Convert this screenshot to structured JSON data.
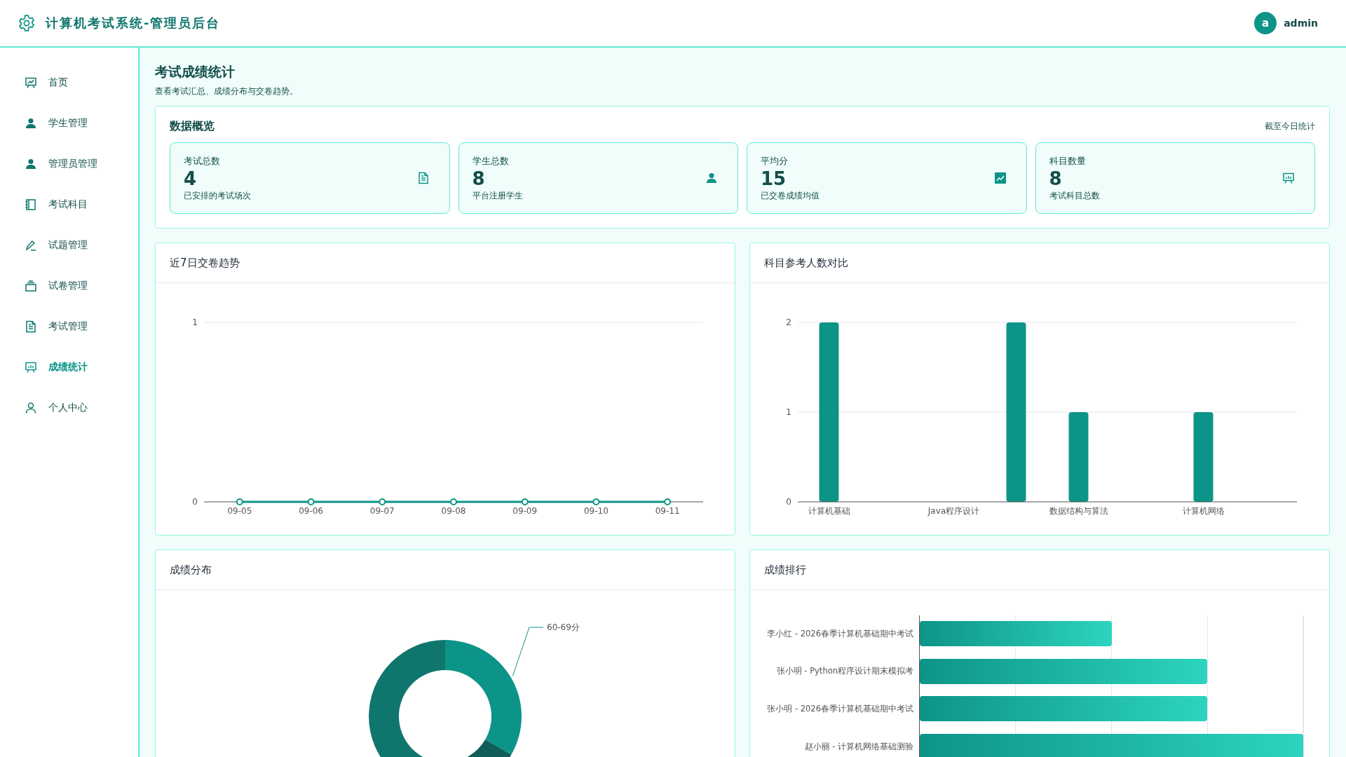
{
  "header": {
    "title": "计算机考试系统-管理员后台",
    "user": {
      "avatar_letter": "a",
      "name": "admin"
    }
  },
  "sidebar": {
    "items": [
      {
        "label": "首页",
        "selected": false
      },
      {
        "label": "学生管理",
        "selected": false
      },
      {
        "label": "管理员管理",
        "selected": false
      },
      {
        "label": "考试科目",
        "selected": false
      },
      {
        "label": "试题管理",
        "selected": false
      },
      {
        "label": "试卷管理",
        "selected": false
      },
      {
        "label": "考试管理",
        "selected": false
      },
      {
        "label": "成绩统计",
        "selected": true
      },
      {
        "label": "个人中心",
        "selected": false
      }
    ]
  },
  "page": {
    "title": "考试成绩统计",
    "subtitle": "查看考试汇总、成绩分布与交卷趋势。"
  },
  "overview": {
    "title": "数据概览",
    "note": "截至今日统计",
    "stats": [
      {
        "label": "考试总数",
        "value": "4",
        "caption": "已安排的考试场次"
      },
      {
        "label": "学生总数",
        "value": "8",
        "caption": "平台注册学生"
      },
      {
        "label": "平均分",
        "value": "15",
        "caption": "已交卷成绩均值"
      },
      {
        "label": "科目数量",
        "value": "8",
        "caption": "考试科目总数"
      }
    ]
  },
  "trend_panel": {
    "title": "近7日交卷趋势",
    "chart_data": {
      "type": "line",
      "categories": [
        "09-05",
        "09-06",
        "09-07",
        "09-08",
        "09-09",
        "09-10",
        "09-11"
      ],
      "series": [
        {
          "color": "#0d9488",
          "marker": "circle",
          "values": [
            0,
            0,
            0,
            0,
            0,
            0,
            0
          ]
        }
      ],
      "yticks": [
        0,
        1
      ],
      "ylim": [
        0,
        1
      ]
    }
  },
  "subject_panel": {
    "title": "科目参考人数对比",
    "chart_data": {
      "type": "bar",
      "categories": [
        "计算机基础",
        null,
        "Java程序设计",
        null,
        "数据结构与算法",
        null,
        "计算机网络",
        null
      ],
      "values": [
        2,
        0,
        0,
        2,
        1,
        0,
        1,
        0
      ],
      "yticks": [
        0,
        1,
        2
      ],
      "ylim": [
        0,
        2
      ]
    }
  },
  "distribution_panel": {
    "title": "成绩分布",
    "slice_label": "60-69分"
  },
  "ranking_panel": {
    "title": "成绩排行",
    "rows": [
      {
        "name": "李小红 - 2026春季计算机基础期中考试",
        "level": 0.5
      },
      {
        "name": "张小明 - Python程序设计期末模拟考",
        "level": 0.75
      },
      {
        "name": "张小明 - 2026春季计算机基础期中考试",
        "level": 0.75
      },
      {
        "name": "赵小丽 - 计算机网络基础测验",
        "level": 1.0
      }
    ]
  }
}
